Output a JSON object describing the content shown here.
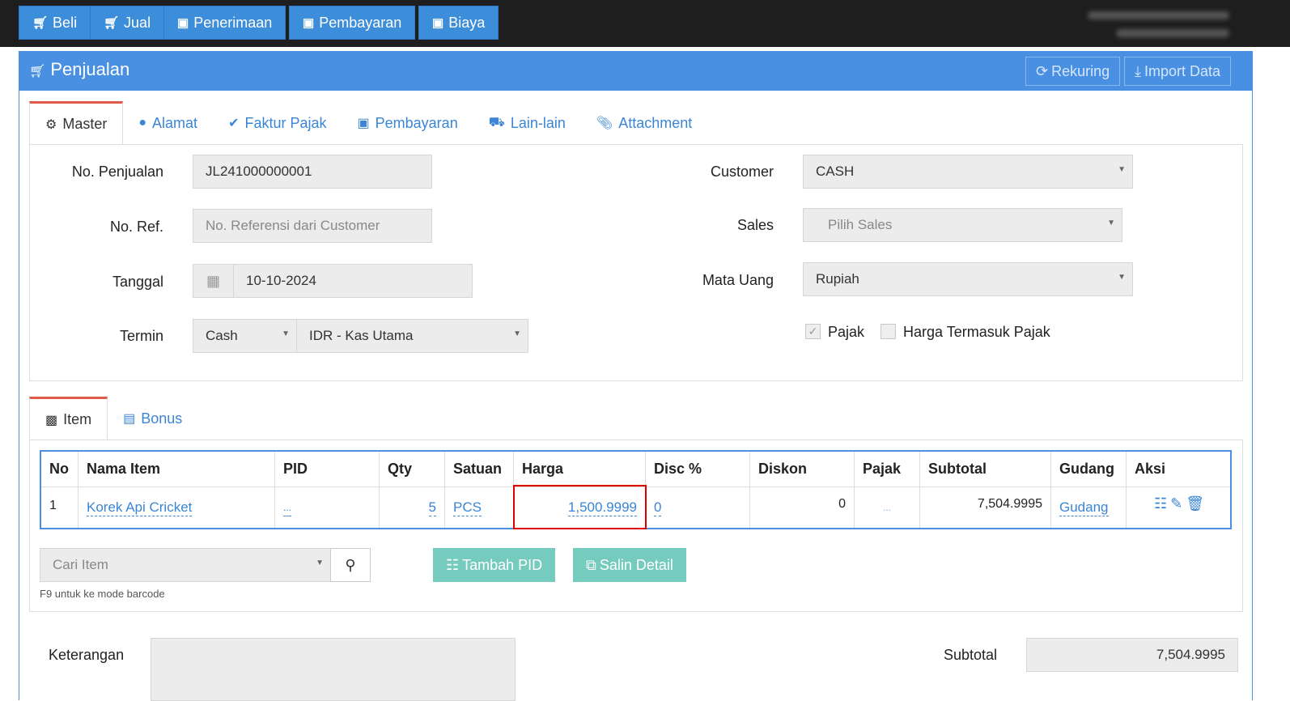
{
  "topbar": {
    "buttons": [
      {
        "icon": "cart-icon",
        "label": "Beli"
      },
      {
        "icon": "cart-icon",
        "label": "Jual"
      },
      {
        "icon": "money-icon",
        "label": "Penerimaan"
      },
      {
        "icon": "money-icon",
        "label": "Pembayaran"
      },
      {
        "icon": "money-icon",
        "label": "Biaya"
      }
    ]
  },
  "panel": {
    "title": "Penjualan",
    "rekuring_label": "Rekuring",
    "import_label": "Import Data"
  },
  "master_tabs": [
    "Master",
    "Alamat",
    "Faktur Pajak",
    "Pembayaran",
    "Lain-lain",
    "Attachment"
  ],
  "form": {
    "no_penjualan_label": "No. Penjualan",
    "no_penjualan_value": "JL241000000001",
    "no_ref_label": "No. Ref.",
    "no_ref_placeholder": "No. Referensi dari Customer",
    "tanggal_label": "Tanggal",
    "tanggal_value": "10-10-2024",
    "termin_label": "Termin",
    "termin_value": "Cash",
    "kas_value": "IDR - Kas Utama",
    "customer_label": "Customer",
    "customer_value": "CASH",
    "sales_label": "Sales",
    "sales_placeholder": "Pilih Sales",
    "mata_uang_label": "Mata Uang",
    "mata_uang_value": "Rupiah",
    "pajak_label": "Pajak",
    "harga_termasuk_pajak_label": "Harga Termasuk Pajak"
  },
  "item_tabs": [
    "Item",
    "Bonus"
  ],
  "table": {
    "headers": [
      "No",
      "Nama Item",
      "PID",
      "Qty",
      "Satuan",
      "Harga",
      "Disc %",
      "Diskon",
      "Pajak",
      "Subtotal",
      "Gudang",
      "Aksi"
    ],
    "rows": [
      {
        "no": "1",
        "nama": "Korek Api Cricket",
        "pid": "...",
        "qty": "5",
        "satuan": "PCS",
        "harga": "1,500.9999",
        "disc": "0",
        "diskon": "0",
        "pajak": "...",
        "subtotal": "7,504.9995",
        "gudang": "Gudang"
      }
    ]
  },
  "search": {
    "placeholder": "Cari Item",
    "hint": "F9 untuk ke mode barcode",
    "tambah_pid_label": "Tambah PID",
    "salin_detail_label": "Salin Detail"
  },
  "footer": {
    "keterangan_label": "Keterangan",
    "subtotal_label": "Subtotal",
    "subtotal_value": "7,504.9995"
  }
}
